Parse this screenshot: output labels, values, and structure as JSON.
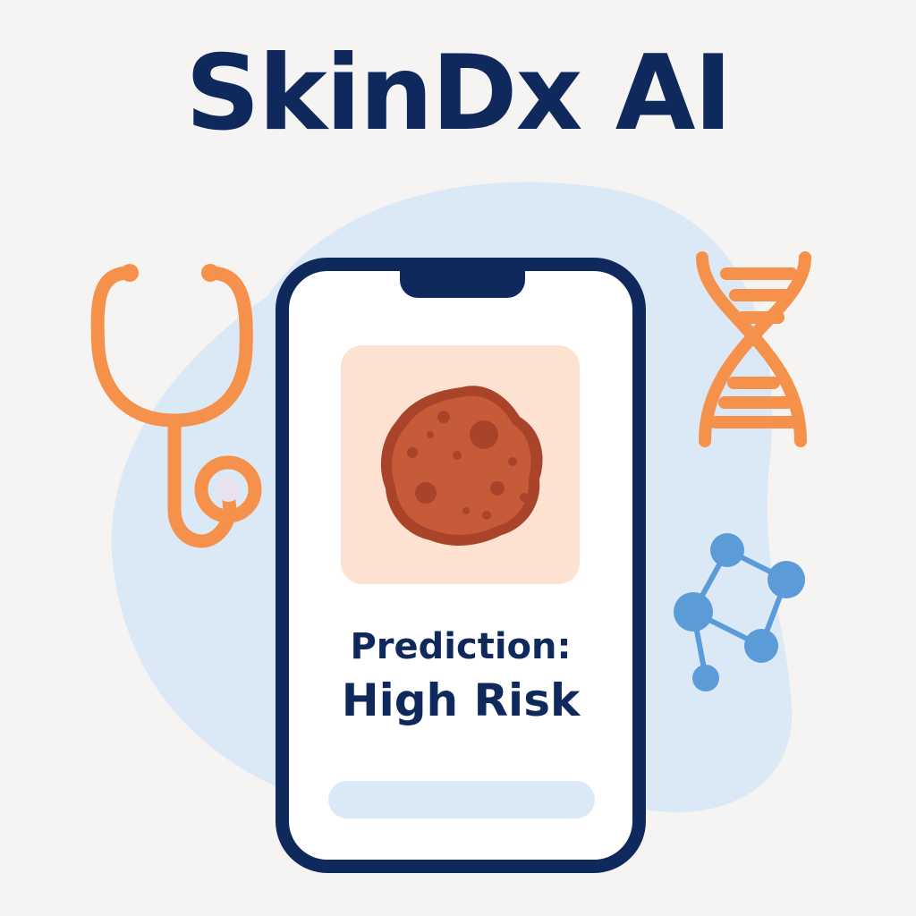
{
  "app": {
    "title": "SkinDx AI"
  },
  "result": {
    "label": "Prediction:",
    "value": "High Risk"
  },
  "colors": {
    "navy": "#10295c",
    "orange": "#f5914a",
    "blue": "#5b9bd8",
    "backdrop": "#dbe9f7",
    "lesion": "#c65a39",
    "lesion_card": "#fde1d1",
    "background": "#f5f4f2"
  },
  "icons": [
    "stethoscope-icon",
    "dna-icon",
    "molecule-icon",
    "lesion-image",
    "phone-notch"
  ]
}
